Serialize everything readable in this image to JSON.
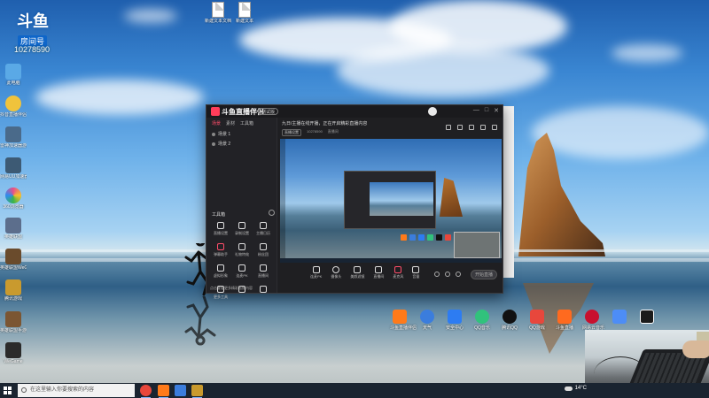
{
  "logo": {
    "text": "斗鱼",
    "sub": "房间号",
    "room_number": "10278590"
  },
  "desktop": {
    "top_files": [
      {
        "label": "新建文本文档",
        "icon": "text-document-icon"
      },
      {
        "label": "新建文本",
        "icon": "text-document-icon"
      }
    ],
    "left_icons": [
      {
        "label": "此电脑",
        "icon": "computer-icon",
        "color": "#5aa9e6"
      },
      {
        "label": "抖音直播伴侣",
        "icon": "folder-icon",
        "color": "#f0c33c"
      },
      {
        "label": "雷神加速器游戏",
        "icon": "game-icon",
        "color": "#4a6a8a"
      },
      {
        "label": "网易UU加速器",
        "icon": "game-icon",
        "color": "#3d5a74"
      },
      {
        "label": "360浏览器",
        "icon": "browser-icon",
        "color": "#e84e8a"
      },
      {
        "label": "英雄联盟",
        "icon": "game-icon",
        "color": "#5c6e8c"
      },
      {
        "label": "英雄联盟WeGame",
        "icon": "game-icon",
        "color": "#6a4b2c"
      },
      {
        "label": "腾讯游戏",
        "icon": "game-icon",
        "color": "#c99a2e"
      },
      {
        "label": "英雄联盟手游",
        "icon": "game-icon",
        "color": "#7b5633"
      },
      {
        "label": "WeGame",
        "icon": "game-icon",
        "color": "#2b2b2b"
      }
    ],
    "dock": [
      {
        "label": "斗鱼直播伴侣",
        "icon": "live-icon",
        "color": "#ff7a1a"
      },
      {
        "label": "天气",
        "icon": "weather-icon",
        "color": "#3b7ddd"
      },
      {
        "label": "安全中心",
        "icon": "shield-icon",
        "color": "#2d7cf2"
      },
      {
        "label": "QQ音乐",
        "icon": "music-icon",
        "color": "#31c27c"
      },
      {
        "label": "腾讯QQ",
        "icon": "qq-icon",
        "color": "#111111"
      },
      {
        "label": "QQ游戏",
        "icon": "game-icon",
        "color": "#e8473c"
      },
      {
        "label": "斗鱼直播",
        "icon": "live-icon",
        "color": "#ff6a1f"
      },
      {
        "label": "网易云音乐",
        "icon": "music-icon",
        "color": "#c8102e"
      },
      {
        "label": "",
        "icon": "blue-app-icon",
        "color": "#4d8df6"
      },
      {
        "label": "",
        "icon": "capcut-icon",
        "color": "#1b1b1b"
      }
    ]
  },
  "app": {
    "title": "斗鱼直播伴侣",
    "version_pill": "测试版",
    "window_controls": [
      "—",
      "□",
      "✕"
    ],
    "left_tabs": [
      "场景",
      "素材",
      "工具箱"
    ],
    "scenes": [
      "场景 1",
      "场景 2"
    ],
    "tools_title": "工具箱",
    "tools": [
      "直播设置",
      "录制设置",
      "主播日历",
      "弹幕助手",
      "礼物特效",
      "粉丝团",
      "虚拟形象",
      "连麦PK",
      "直播间",
      "更多工具",
      "",
      ""
    ],
    "bottom_note": "点击查看更多精彩直播内容",
    "main_head": "九日/主播在线开播，正在开启精彩直播内容",
    "head_row": [
      "直播设置",
      "10278590",
      "直播间"
    ],
    "controls": [
      "连麦PK",
      "摄像头",
      "美颜滤镜",
      "直播间",
      "麦克风",
      "音量"
    ],
    "go_live": "开始直播"
  },
  "taskbar": {
    "search_placeholder": "在这里输入你要搜索的内容",
    "weather": "14°C"
  }
}
